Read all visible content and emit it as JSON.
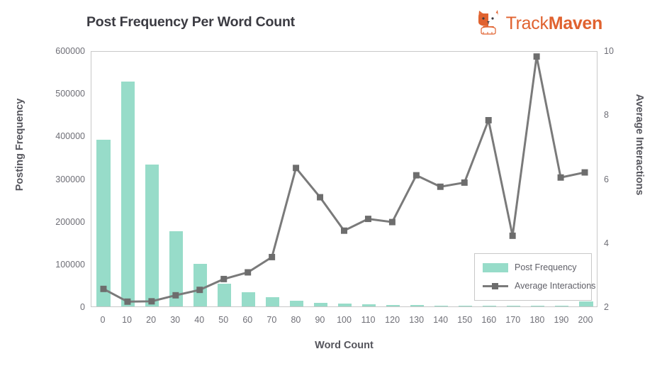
{
  "header": {
    "title": "Post Frequency Per Word Count",
    "brand_name_light": "Track",
    "brand_name_bold": "Maven",
    "brand_color": "#e0622f",
    "logo_icon": "corgi-dog-icon"
  },
  "legend": {
    "items": [
      {
        "label": "Post Frequency",
        "color": "#97dcc9",
        "type": "bar"
      },
      {
        "label": "Average Interactions",
        "color": "#7a7a7a",
        "type": "line-marker"
      }
    ]
  },
  "chart_data": {
    "type": "bar",
    "title": "Post Frequency Per Word Count",
    "xlabel": "Word Count",
    "ylabel": "Posting Frequency",
    "y2label": "Average Interactions",
    "grid": false,
    "legend_position": "bottom-right",
    "categories": [
      0,
      10,
      20,
      30,
      40,
      50,
      60,
      70,
      80,
      90,
      100,
      110,
      120,
      130,
      140,
      150,
      160,
      170,
      180,
      190,
      200
    ],
    "x_tick_labels": [
      "0",
      "10",
      "20",
      "30",
      "40",
      "50",
      "60",
      "70",
      "80",
      "90",
      "100",
      "110",
      "120",
      "130",
      "140",
      "150",
      "160",
      "170",
      "180",
      "190",
      "200"
    ],
    "y_tick_labels": [
      "0",
      "100000",
      "200000",
      "300000",
      "400000",
      "500000",
      "600000"
    ],
    "y2_tick_labels": [
      "2",
      "4",
      "6",
      "8",
      "10"
    ],
    "ylim": [
      0,
      600000
    ],
    "y2lim": [
      2,
      10
    ],
    "series": [
      {
        "name": "Post Frequency",
        "type": "bar",
        "axis": "left",
        "color": "#97dcc9",
        "values": [
          390000,
          527000,
          333000,
          176000,
          99000,
          54000,
          34000,
          21000,
          14000,
          9000,
          6500,
          4800,
          3500,
          2600,
          2000,
          1600,
          1300,
          1000,
          900,
          800,
          12000
        ]
      },
      {
        "name": "Average Interactions",
        "type": "line",
        "axis": "right",
        "color": "#7a7a7a",
        "marker": "square",
        "values": [
          2.55,
          2.15,
          2.16,
          2.35,
          2.52,
          2.86,
          3.07,
          3.55,
          6.35,
          5.43,
          4.38,
          4.75,
          4.65,
          6.12,
          5.76,
          5.89,
          7.85,
          4.22,
          9.85,
          6.05,
          6.21
        ]
      }
    ]
  }
}
